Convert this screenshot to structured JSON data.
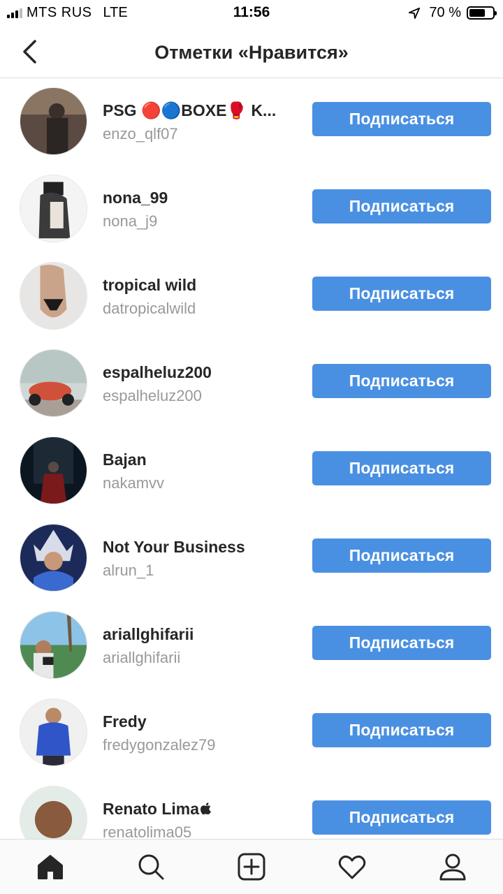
{
  "status_bar": {
    "carrier": "MTS RUS",
    "network": "LTE",
    "time": "11:56",
    "battery": "70 %",
    "battery_level": 0.7
  },
  "header": {
    "title": "Отметки «Нравится»",
    "back_icon": "chevron-left-icon"
  },
  "users": [
    {
      "name": "PSG 🔴🔵BOXE🥊 K...",
      "handle": "enzo_qlf07",
      "button": "Подписаться"
    },
    {
      "name": "nona_99",
      "handle": "nona_j9",
      "button": "Подписаться"
    },
    {
      "name": "tropical wild",
      "handle": "datropicalwild",
      "button": "Подписаться"
    },
    {
      "name": "espalheluz200",
      "handle": "espalheluz200",
      "button": "Подписаться"
    },
    {
      "name": "Bajan",
      "handle": "nakamvv",
      "button": "Подписаться"
    },
    {
      "name": "Not Your Business",
      "handle": "alrun_1",
      "button": "Подписаться"
    },
    {
      "name": "ariallghifarii",
      "handle": "ariallghifarii",
      "button": "Подписаться"
    },
    {
      "name": "Fredy",
      "handle": "fredygonzalez79",
      "button": "Подписаться"
    },
    {
      "name": "Renato Lima",
      "handle": "renatolima05",
      "button": "Подписаться"
    }
  ],
  "tabbar": {
    "items": [
      "home-icon",
      "search-icon",
      "add-post-icon",
      "heart-icon",
      "profile-icon"
    ]
  },
  "colors": {
    "follow_button": "#4a90e2",
    "handle_text": "#999999",
    "divider": "#dbdbdb"
  }
}
